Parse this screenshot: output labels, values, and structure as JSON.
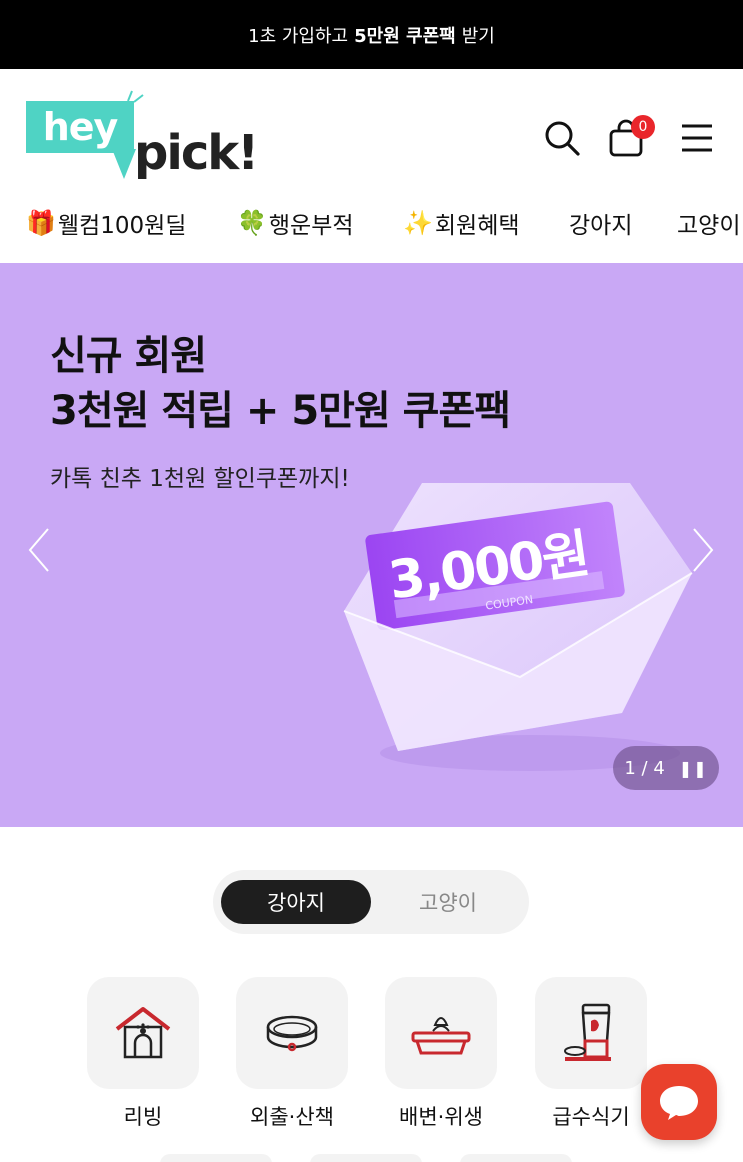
{
  "promo_bar": {
    "text_before": "1초 가입하고",
    "text_bold": "5만원 쿠폰팩",
    "text_after": "받기"
  },
  "header": {
    "logo_hey": "hey",
    "logo_pick": "pick!",
    "cart_count": "0",
    "brand_color": "#4fd3c4",
    "badge_color": "#e9262b"
  },
  "nav": {
    "items": [
      {
        "emoji": "🎁",
        "label": "웰컴100원딜"
      },
      {
        "emoji": "🍀",
        "label": "행운부적"
      },
      {
        "emoji": "✨",
        "label": "회원혜택"
      },
      {
        "emoji": "",
        "label": "강아지"
      },
      {
        "emoji": "",
        "label": "고양이"
      }
    ]
  },
  "banner": {
    "line1": "신규 회원",
    "line2": "3천원 적립 + 5만원 쿠폰팩",
    "subtitle": "카톡 친추 1천원 할인쿠폰까지!",
    "coupon_amount": "3,000원",
    "coupon_small": "COUPON",
    "pager": "1 / 4",
    "background": "#c9a8f5"
  },
  "pet_toggle": {
    "active": "강아지",
    "inactive": "고양이"
  },
  "categories": [
    {
      "label": "리빙",
      "icon": "dog-house-icon"
    },
    {
      "label": "외출·산책",
      "icon": "collar-icon"
    },
    {
      "label": "배변·위생",
      "icon": "litter-tray-icon"
    },
    {
      "label": "급수식기",
      "icon": "water-dispenser-icon"
    }
  ]
}
